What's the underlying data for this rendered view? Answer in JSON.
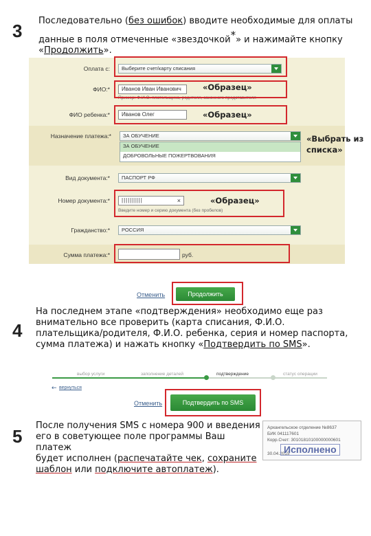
{
  "step3": {
    "number": "3",
    "line1_pre": "Последовательно (",
    "line1_link": "без ошибок",
    "line1_post": ") вводите необходимые для оплаты",
    "line2_pre": "данные в поля отмеченные «звездочкой",
    "asterisk": "*",
    "line2_post": "» и нажимайте кнопку",
    "line3_pre": "«",
    "line3_link": "Продолжить",
    "line3_post": "»."
  },
  "form": {
    "fields": {
      "payment_from": {
        "label": "Оплата с:",
        "value": "Выберите счет/карту списания"
      },
      "fio": {
        "label": "ФИО:*",
        "value": "Иванов Иван Иванович",
        "hint": "Пример: Ф.И.О. плательщика, родителя, законного представителя"
      },
      "child_fio": {
        "label": "ФИО ребенка:*",
        "value": "Иванов Олег"
      },
      "purpose": {
        "label": "Назначение платежа:*",
        "value": "ЗА ОБУЧЕНИЕ",
        "options": [
          "ЗА ОБУЧЕНИЕ",
          "ДОБРОВОЛЬНЫЕ ПОЖЕРТВОВАНИЯ"
        ]
      },
      "doc_type": {
        "label": "Вид документа:*",
        "value": "ПАСПОРТ РФ"
      },
      "doc_number": {
        "label": "Номер документа:*",
        "value": "||||||||||",
        "hint": "Введите номер и серию документа (без пробелов)"
      },
      "citizenship": {
        "label": "Гражданство:*",
        "value": "РОССИЯ"
      },
      "amount": {
        "label": "Сумма платежа:*",
        "value": "",
        "unit": "руб."
      }
    },
    "annotations": {
      "sample1": "«Образец»",
      "sample2": "«Образец»",
      "sample3": "«Образец»",
      "choose": "«Выбрать из списка»"
    },
    "cancel_link": "Отменить",
    "continue_button": "Продолжить"
  },
  "step4": {
    "number": "4",
    "line1": "На последнем этапе «подтверждения» необходимо еще раз",
    "line2": "внимательно все проверить (карта списания, Ф.И.О.",
    "line3": "плательщика/родителя, Ф.И.О. ребенка, серия и номер паспорта,",
    "line4_pre": "сумма платежа) и нажать кнопку «",
    "line4_link": "Подтвердить по SMS",
    "line4_post": "».",
    "progress_steps": [
      "выбор услуги",
      "заполнение деталей",
      "подтверждение",
      "статус операции"
    ],
    "progress_current_index": 2,
    "back_link": "вернуться",
    "cancel_link": "Отменить",
    "confirm_button": "Подтвердить по SMS"
  },
  "step5": {
    "number": "5",
    "line1": "После получения SMS с номера 900 и введения",
    "line2": "его в советующее поле программы Ваш платеж",
    "line3_pre": "будет исполнен (",
    "line3_link1": "распечатайте чек",
    "line3_mid": ", ",
    "line3_link2": "сохраните",
    "line4_link": "шаблон",
    "line4_mid": " или ",
    "line4_link2": "подключите автоплатеж",
    "line4_post": ").",
    "stamp": {
      "line1": "Архангельское отделение №8637",
      "line2": "БИК 041117601",
      "line3": "Корр.Счет: 30101810100000000601",
      "status": "Исполнено",
      "date": "30.04.2015"
    }
  },
  "colors": {
    "accent_red": "#d3272c",
    "button_green": "#2b8a35",
    "form_bg": "#f3f0d8"
  }
}
